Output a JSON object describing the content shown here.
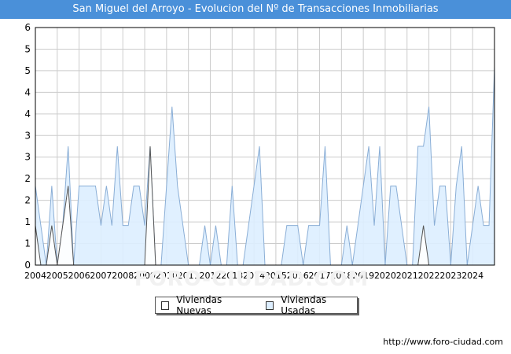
{
  "title": "San Miguel del Arroyo - Evolucion del Nº de Transacciones Inmobiliarias",
  "footer_url": "http://www.foro-ciudad.com",
  "watermark": "FORO-CIUDAD.COM",
  "colors": {
    "title_bg": "#4a90d9",
    "nuevas_fill": "#ffffff",
    "nuevas_line": "#555555",
    "usadas_fill": "#ddeeff",
    "usadas_line": "#8aaed6",
    "grid": "#cccccc"
  },
  "chart_data": {
    "type": "area",
    "x_tick_labels": [
      "2004",
      "2005",
      "2006",
      "2007",
      "2008",
      "2009",
      "2010",
      "2011",
      "2012",
      "2013",
      "2014",
      "2015",
      "2016",
      "2017",
      "2018",
      "2019",
      "2020",
      "2021",
      "2022",
      "2023",
      "2024"
    ],
    "y_ticks": [
      0,
      1,
      1,
      2,
      2,
      3,
      3,
      4,
      4,
      5,
      5,
      6
    ],
    "ylim": [
      0,
      6
    ],
    "xlim": [
      2004.0,
      2025.0
    ],
    "grid": true,
    "legend_position": "bottom",
    "series": [
      {
        "name": "Viviendas Nuevas",
        "style": "nuevas",
        "points": [
          [
            2004.0,
            1
          ],
          [
            2004.25,
            0
          ],
          [
            2004.5,
            0
          ],
          [
            2004.75,
            1
          ],
          [
            2005.0,
            0
          ],
          [
            2005.25,
            1
          ],
          [
            2005.5,
            2
          ],
          [
            2005.75,
            0
          ],
          [
            2009.0,
            0
          ],
          [
            2009.25,
            3
          ],
          [
            2009.5,
            0
          ],
          [
            2021.5,
            0
          ],
          [
            2021.75,
            1
          ],
          [
            2022.0,
            0
          ]
        ]
      },
      {
        "name": "Viviendas Usadas",
        "style": "usadas",
        "points": [
          [
            2004.0,
            2
          ],
          [
            2004.25,
            1
          ],
          [
            2004.5,
            0
          ],
          [
            2004.75,
            2
          ],
          [
            2005.0,
            0
          ],
          [
            2005.25,
            1
          ],
          [
            2005.5,
            3
          ],
          [
            2005.75,
            0
          ],
          [
            2006.0,
            2
          ],
          [
            2006.25,
            2
          ],
          [
            2006.5,
            2
          ],
          [
            2006.75,
            2
          ],
          [
            2007.0,
            1
          ],
          [
            2007.25,
            2
          ],
          [
            2007.5,
            1
          ],
          [
            2007.75,
            3
          ],
          [
            2008.0,
            1
          ],
          [
            2008.25,
            1
          ],
          [
            2008.5,
            2
          ],
          [
            2008.75,
            2
          ],
          [
            2009.0,
            1
          ],
          [
            2009.25,
            3
          ],
          [
            2009.5,
            0
          ],
          [
            2009.75,
            0
          ],
          [
            2010.0,
            2
          ],
          [
            2010.25,
            4
          ],
          [
            2010.5,
            2
          ],
          [
            2010.75,
            1
          ],
          [
            2011.0,
            0
          ],
          [
            2011.25,
            0
          ],
          [
            2011.5,
            0
          ],
          [
            2011.75,
            1
          ],
          [
            2012.0,
            0
          ],
          [
            2012.25,
            1
          ],
          [
            2012.5,
            0
          ],
          [
            2012.75,
            0
          ],
          [
            2013.0,
            2
          ],
          [
            2013.25,
            0
          ],
          [
            2013.5,
            0
          ],
          [
            2013.75,
            1
          ],
          [
            2014.0,
            2
          ],
          [
            2014.25,
            3
          ],
          [
            2014.5,
            0
          ],
          [
            2014.75,
            0
          ],
          [
            2015.0,
            0
          ],
          [
            2015.25,
            0
          ],
          [
            2015.5,
            1
          ],
          [
            2015.75,
            1
          ],
          [
            2016.0,
            1
          ],
          [
            2016.25,
            0
          ],
          [
            2016.5,
            1
          ],
          [
            2016.75,
            1
          ],
          [
            2017.0,
            1
          ],
          [
            2017.25,
            3
          ],
          [
            2017.5,
            0
          ],
          [
            2017.75,
            0
          ],
          [
            2018.0,
            0
          ],
          [
            2018.25,
            1
          ],
          [
            2018.5,
            0
          ],
          [
            2018.75,
            1
          ],
          [
            2019.0,
            2
          ],
          [
            2019.25,
            3
          ],
          [
            2019.5,
            1
          ],
          [
            2019.75,
            3
          ],
          [
            2020.0,
            0
          ],
          [
            2020.25,
            2
          ],
          [
            2020.5,
            2
          ],
          [
            2020.75,
            1
          ],
          [
            2021.0,
            0
          ],
          [
            2021.25,
            0
          ],
          [
            2021.5,
            3
          ],
          [
            2021.75,
            3
          ],
          [
            2022.0,
            4
          ],
          [
            2022.25,
            1
          ],
          [
            2022.5,
            2
          ],
          [
            2022.75,
            2
          ],
          [
            2023.0,
            0
          ],
          [
            2023.25,
            2
          ],
          [
            2023.5,
            3
          ],
          [
            2023.75,
            0
          ],
          [
            2024.0,
            1
          ],
          [
            2024.25,
            2
          ],
          [
            2024.5,
            1
          ],
          [
            2024.75,
            1
          ],
          [
            2025.0,
            5
          ]
        ]
      }
    ]
  }
}
